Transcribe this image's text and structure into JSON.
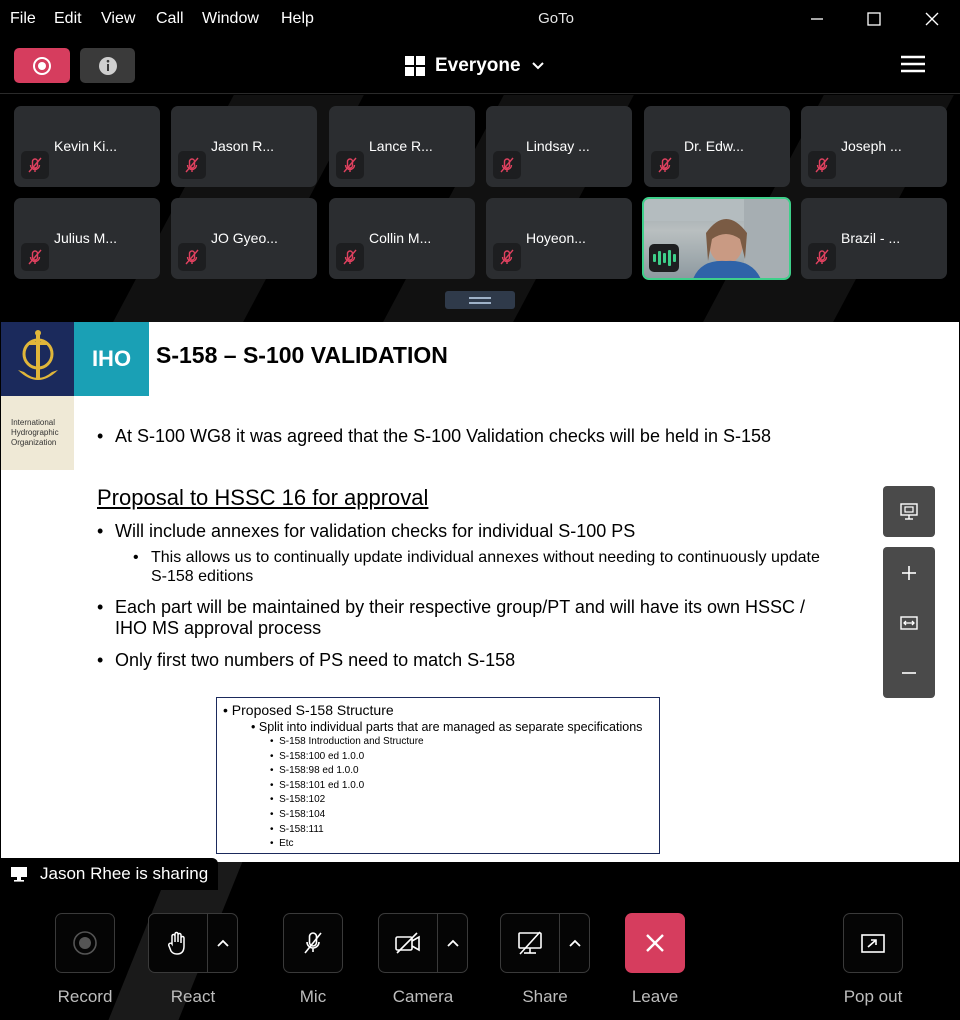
{
  "window": {
    "title": "GoTo",
    "menu": [
      "File",
      "Edit",
      "View",
      "Call",
      "Window",
      "Help"
    ]
  },
  "toolbar": {
    "view_label": "Everyone"
  },
  "participants": [
    {
      "name": "Kevin Ki...",
      "muted": true
    },
    {
      "name": "Jason R...",
      "muted": true
    },
    {
      "name": "Lance R...",
      "muted": true
    },
    {
      "name": "Lindsay ...",
      "muted": true
    },
    {
      "name": "Dr. Edw...",
      "muted": true
    },
    {
      "name": "Joseph ...",
      "muted": true
    },
    {
      "name": "Julius M...",
      "muted": true
    },
    {
      "name": "JO Gyeo...",
      "muted": true
    },
    {
      "name": "Collin M...",
      "muted": true
    },
    {
      "name": "Hoyeon...",
      "muted": true
    },
    {
      "name": "",
      "muted": false,
      "video": true,
      "speaking": true
    },
    {
      "name": "Brazil - ...",
      "muted": true
    }
  ],
  "slide": {
    "logo_text": "IHO",
    "org_lines": [
      "International",
      "Hydrographic",
      "Organization"
    ],
    "title": "S-158 – S-100 VALIDATION",
    "bullet_intro": "At S-100 WG8 it was agreed that the S-100 Validation checks will be held in S-158",
    "section_heading": "Proposal to HSSC 16 for approval",
    "bullet_annexes": "Will include annexes for validation checks for individual S-100 PS",
    "sub_bullet_line1": "This allows us to continually update individual annexes without needing to continuously update",
    "sub_bullet_line2": "S-158 editions",
    "bullet_parts_line1": "Each part will be maintained by their respective group/PT and will have its own HSSC /",
    "bullet_parts_line2": "IHO MS approval process",
    "bullet_numbers": "Only first two numbers of PS need to match S-158",
    "embedded": {
      "level1": "Proposed S-158 Structure",
      "level2": "Split into individual parts that are managed as separate specifications",
      "level3": [
        "S-158 Introduction and Structure",
        "S-158:100 ed 1.0.0",
        "S-158:98 ed 1.0.0",
        "S-158:101 ed 1.0.0",
        "S-158:102",
        "S-158:104",
        "S-158:111",
        "Etc"
      ]
    }
  },
  "sharing_banner": "Jason Rhee is sharing",
  "controls": {
    "record": "Record",
    "react": "React",
    "mic": "Mic",
    "camera": "Camera",
    "share": "Share",
    "leave": "Leave",
    "popout": "Pop out"
  },
  "colors": {
    "accent_red": "#d63d5e",
    "speaking_green": "#3ed08a",
    "tile_bg": "#2b2d30"
  }
}
